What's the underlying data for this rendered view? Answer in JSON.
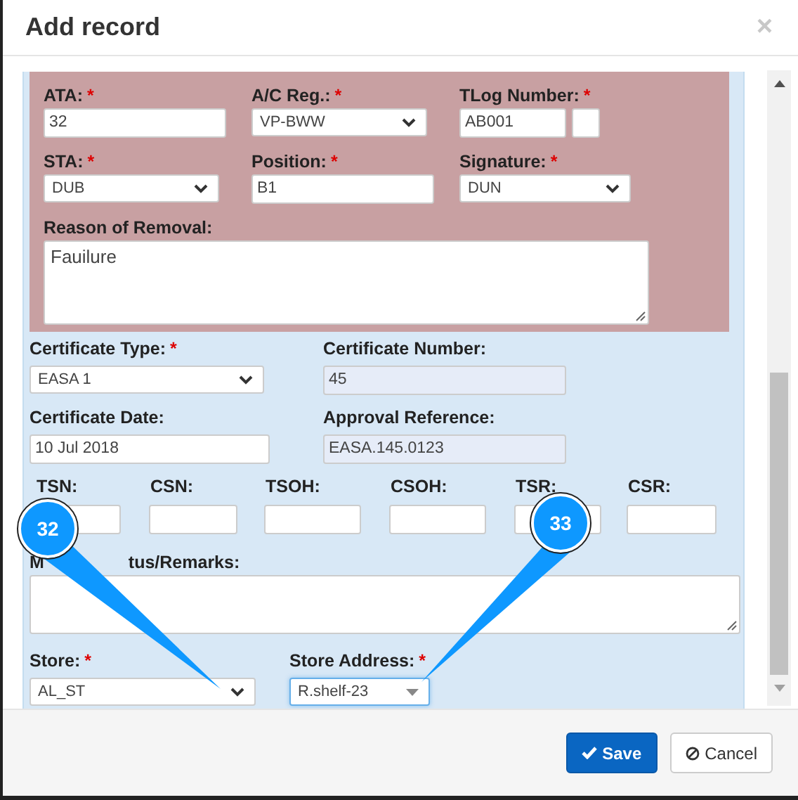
{
  "dialog": {
    "title": "Add record",
    "close": "×"
  },
  "removal_section": {
    "rows": [
      [
        {
          "label": "ATA:",
          "required_mark": "*",
          "kind": "text",
          "value": "32"
        },
        {
          "label": "A/C Reg.:",
          "required_mark": "*",
          "kind": "select",
          "value": "VP-BWW"
        },
        {
          "label": "TLog Number:",
          "required_mark": "*",
          "kind": "text_with_suffix",
          "value": "AB001"
        }
      ],
      [
        {
          "label": "STA:",
          "required_mark": "*",
          "kind": "select",
          "value": "DUB"
        },
        {
          "label": "Position:",
          "required_mark": "*",
          "kind": "text",
          "value": "B1"
        },
        {
          "label": "Signature:",
          "required_mark": "*",
          "kind": "select",
          "value": "DUN"
        }
      ]
    ],
    "reason": {
      "label": "Reason of Removal:",
      "value": "Fauilure"
    }
  },
  "certificate_section": {
    "rows": [
      [
        {
          "label": "Certificate Type:",
          "required_mark": "*",
          "kind": "select",
          "value": "EASA 1"
        },
        {
          "label": "Certificate Number:",
          "kind": "readonly",
          "value": "45"
        }
      ],
      [
        {
          "label": "Certificate Date:",
          "kind": "text",
          "value": "10 Jul 2018"
        },
        {
          "label": "Approval Reference:",
          "kind": "readonly",
          "value": "EASA.145.0123"
        }
      ]
    ],
    "times": [
      {
        "label": "TSN:"
      },
      {
        "label": "CSN:"
      },
      {
        "label": "TSOH:"
      },
      {
        "label": "CSOH:"
      },
      {
        "label": "TSR:"
      },
      {
        "label": "CSR:"
      }
    ],
    "remarks": {
      "label_parts": [
        "M",
        "tus/Remarks:"
      ]
    },
    "store": [
      {
        "label": "Store:",
        "required_mark": "*",
        "kind": "select",
        "value": "AL_ST",
        "focused": false
      },
      {
        "label": "Store Address:",
        "required_mark": "*",
        "kind": "combo",
        "value": "R.shelf-23",
        "focused": true
      }
    ]
  },
  "callouts": [
    {
      "number": "32"
    },
    {
      "number": "33"
    }
  ],
  "buttons": [
    {
      "label": "Save",
      "kind": "primary"
    },
    {
      "label": "Cancel",
      "kind": "default"
    }
  ]
}
